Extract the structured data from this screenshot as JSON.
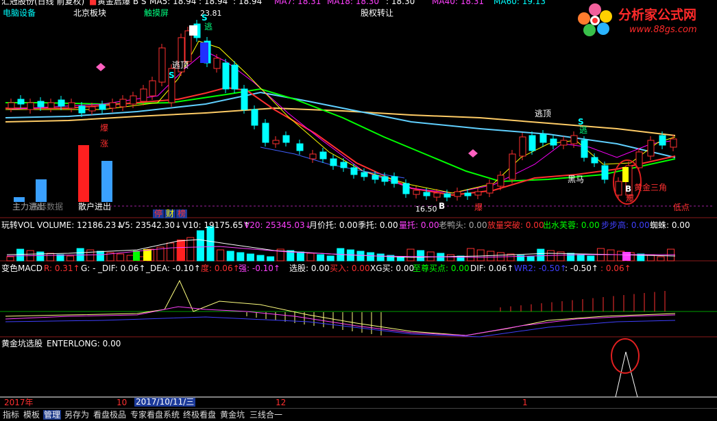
{
  "colors": {
    "up": "#ff3030",
    "down": "#00ffff",
    "ma5": "#ffffff",
    "ma10": "#ffff00",
    "ma20": "#ff00ff",
    "ma40": "#00ff00",
    "ma60": "#00ffff",
    "gold": "#ffcc66"
  },
  "header": {
    "title_trunc": "汇冠股份(日线 前复权)",
    "indicator": "黄金启爆 B S",
    "ma_items": [
      {
        "label": "MA5: 18.94",
        "color": "#ffffff"
      },
      {
        "label": ": 18.94",
        "color": "#ffffff"
      },
      {
        "label": ": 18.94",
        "color": "#ffffff"
      },
      {
        "label": "MA7: 18.31",
        "color": "#ff40ff"
      },
      {
        "label": "MA18: 18.30",
        "color": "#ff40ff"
      },
      {
        "label": ": 18.30",
        "color": "#ffffff"
      },
      {
        "label": "MA40: 18.31",
        "color": "#ff40ff"
      },
      {
        "label": "MA60: 19.13",
        "color": "#00ffff"
      }
    ],
    "tags": [
      "电脑设备",
      "北京板块",
      "触摸屏",
      "股权转让"
    ]
  },
  "logo": {
    "text": "分析家公式网",
    "url": "www.88gs.com"
  },
  "main_chart": {
    "high_label": "23.81",
    "low_label": "16.50",
    "labels": [
      "逃顶",
      "逃顶",
      "黑马",
      "黄金三角",
      "爆",
      "涨",
      "爆",
      "爆",
      "低点",
      "主力进出",
      "散户进出",
      "指标数据",
      "B",
      "S",
      "S",
      "逃",
      "逃"
    ],
    "badges": [
      "停",
      "财",
      "榜"
    ]
  },
  "vol_panel": {
    "items": [
      {
        "label": "玩转VOL VOLUME: 12186.23↓",
        "color": "#ffffff"
      },
      {
        "label": "V5: 23542.30↓",
        "color": "#ffffff"
      },
      {
        "label": "V10: 19175.65↑",
        "color": "#ffffff"
      },
      {
        "label": "V20: 25345.03↓",
        "color": "#ff40ff"
      },
      {
        "label": "月价托: 0.00",
        "color": "#ffffff"
      },
      {
        "label": "季托: 0.00",
        "color": "#ffffff"
      },
      {
        "label": "量托: 0.00",
        "color": "#ff40ff"
      },
      {
        "label": "老鸭头: 0.00",
        "color": "#aaaaaa"
      },
      {
        "label": "放量突破: 0.00",
        "color": "#ff3030"
      },
      {
        "label": "出水芙蓉: 0.00",
        "color": "#00ff00"
      },
      {
        "label": "步步高: 0.00",
        "color": "#4040ff"
      },
      {
        "label": "蜘蛛: 0.00",
        "color": "#ffffff"
      }
    ]
  },
  "macd_panel": {
    "items": [
      {
        "label": "变色MACD",
        "color": "#ffffff"
      },
      {
        "label": "R: 0.31↑",
        "color": "#ff3030"
      },
      {
        "label": "G: -",
        "color": "#ffffff"
      },
      {
        "label": "_DIF: 0.06↑",
        "color": "#ffffff"
      },
      {
        "label": "_DEA: -0.10↑",
        "color": "#ffffff"
      },
      {
        "label": "度: 0.06↑",
        "color": "#ff3030"
      },
      {
        "label": "强: -0.10↑",
        "color": "#ff40ff"
      },
      {
        "label": "选股: 0.00",
        "color": "#ffffff"
      },
      {
        "label": "买入: 0.00",
        "color": "#ff3030"
      },
      {
        "label": "XG买: 0.00",
        "color": "#ffffff"
      },
      {
        "label": "至尊买点: 0.00",
        "color": "#00ff00"
      },
      {
        "label": "DIF: 0.06↑",
        "color": "#ffffff"
      },
      {
        "label": "WR2: -0.50↑",
        "color": "#4040ff"
      },
      {
        "label": ": -0.50↑",
        "color": "#ffffff"
      },
      {
        "label": ": 0.06↑",
        "color": "#ff3030"
      }
    ]
  },
  "jinkeng_panel": {
    "title": "黄金坑选股",
    "value": "ENTERLONG: 0.00"
  },
  "time_axis": {
    "labels": [
      "2017年",
      "10",
      "2017/10/11/三",
      "12",
      "1"
    ]
  },
  "toolbar": {
    "items": [
      "指标",
      "模板",
      "管理",
      "另存为",
      "看盘极品",
      "专家看盘系统",
      "终极看盘",
      "黄金坑",
      "三线合一"
    ],
    "active_index": 2
  }
}
